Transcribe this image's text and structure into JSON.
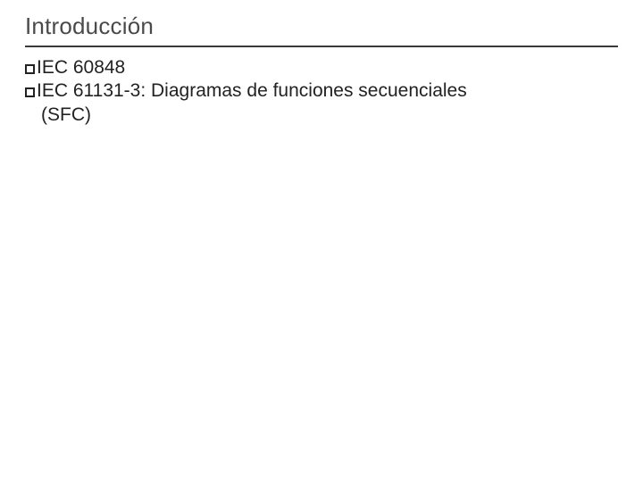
{
  "slide": {
    "title": "Introducción",
    "bullets": [
      {
        "text": "IEC 60848"
      },
      {
        "text": "IEC 61131-3: Diagramas de funciones secuenciales",
        "continuation": "(SFC)"
      }
    ]
  }
}
